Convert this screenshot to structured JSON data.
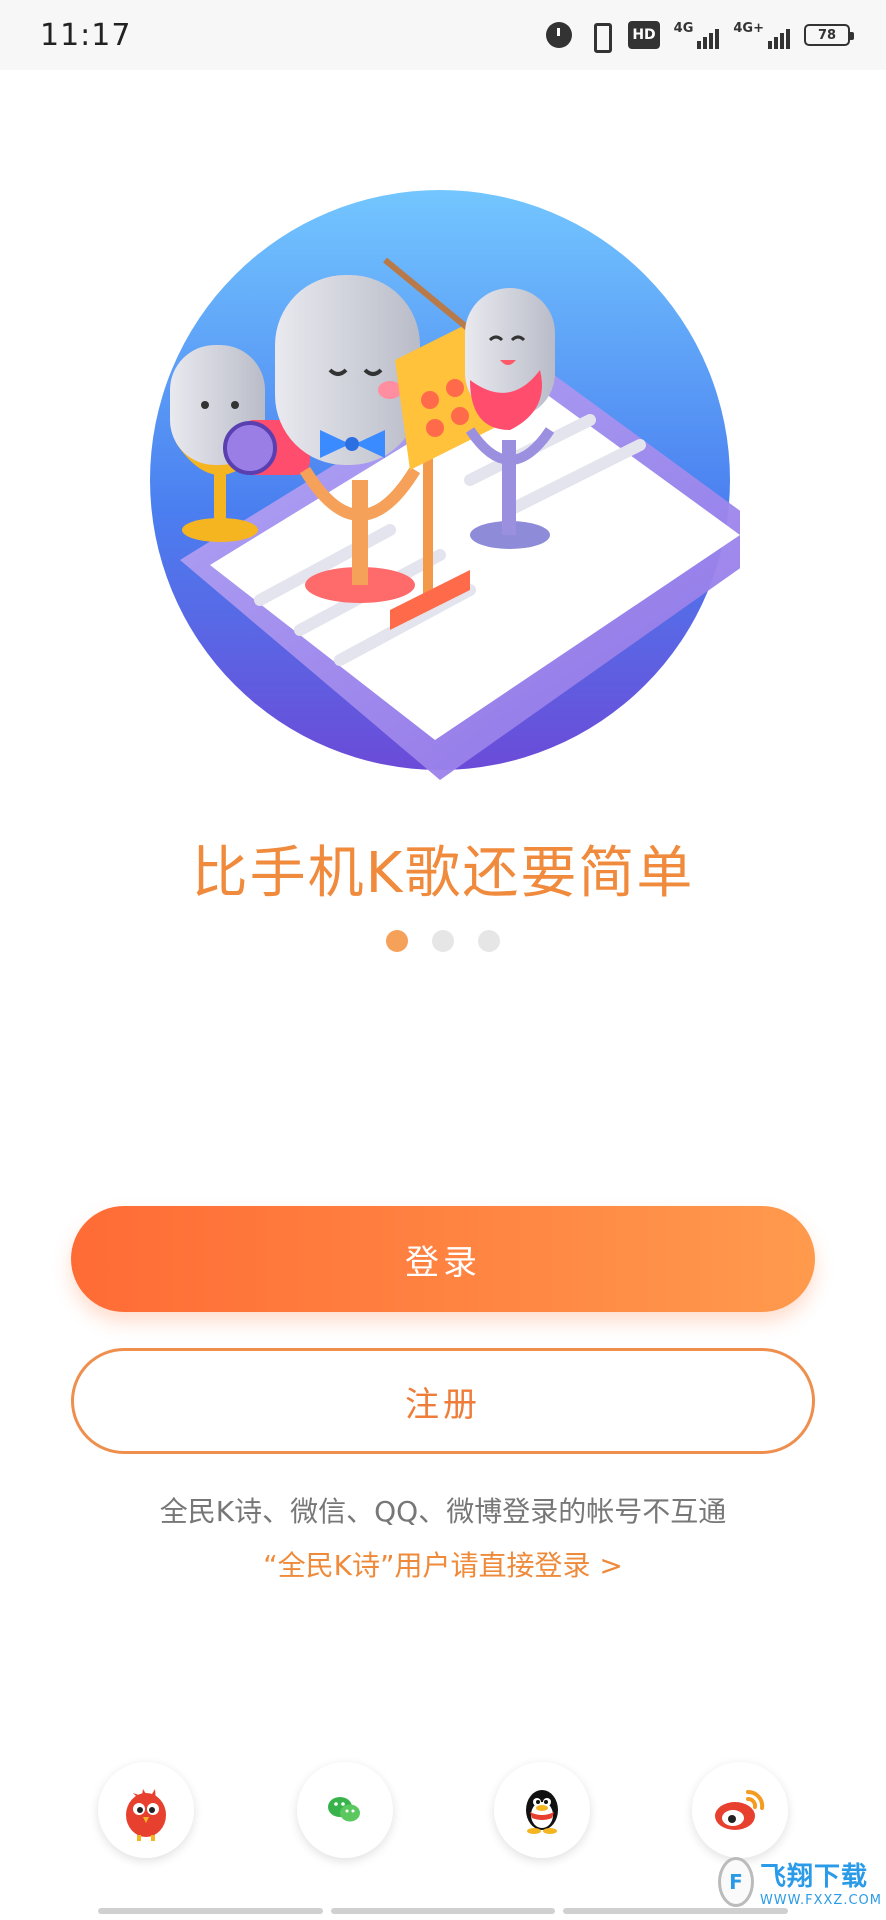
{
  "status_bar": {
    "time": "11:17",
    "hd_label": "HD",
    "net1_label": "4G",
    "net2_label": "4G+",
    "battery": "78"
  },
  "slogan": "比手机K歌还要简单",
  "carousel": {
    "total_pages": 3,
    "active_page": 1
  },
  "buttons": {
    "login": "登录",
    "register": "注册"
  },
  "notice": "全民K诗、微信、QQ、微博登录的帐号不互通",
  "direct_login_link": "“全民K诗”用户请直接登录 >",
  "social_login": [
    {
      "icon": "bird-mascot-icon"
    },
    {
      "icon": "wechat-icon"
    },
    {
      "icon": "qq-penguin-icon"
    },
    {
      "icon": "weibo-icon"
    }
  ],
  "watermark": {
    "cn_text": "飞翔下载",
    "url": "WWW.FXXZ.COM"
  },
  "colors": {
    "accent": "#f08a3c",
    "button_gradient_start": "#ff6b35",
    "button_gradient_end": "#ff9a4d"
  }
}
